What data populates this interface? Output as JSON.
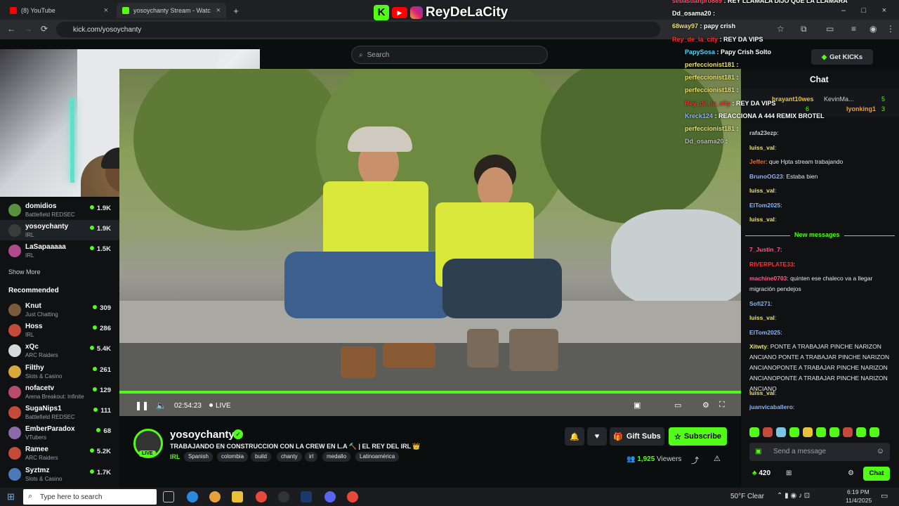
{
  "browser": {
    "tabs": [
      {
        "label": "(8) YouTube",
        "active": false
      },
      {
        "label": "yosoychanty Stream - Watc",
        "active": true
      }
    ],
    "url": "kick.com/yosoychanty",
    "new_tab": "+"
  },
  "overlay": {
    "logo_text": "ReyDeLaCity",
    "messages": [
      {
        "user": "sebastianpro889",
        "text": "REY LLAMALA DIJO QUE LA LLAMARA"
      },
      {
        "user": "Dd_osama20",
        "text": ""
      },
      {
        "user": "68way97",
        "text": "papy crish"
      },
      {
        "user": "Rey_de_la_city",
        "text": "REY DA VIPS"
      },
      {
        "user": "PapySosa",
        "text": "Papy Crish Solto"
      },
      {
        "user": "perfeccionist181",
        "text": ""
      },
      {
        "user": "perfeccionist181",
        "text": ""
      },
      {
        "user": "perfeccionist181",
        "text": ""
      },
      {
        "user": "Rey_de_la_city",
        "text": "REY DA VIPS"
      },
      {
        "user": "Kreck124",
        "text": "REACCIONA A 444 REMIX BROTEL"
      },
      {
        "user": "perfeccionist181",
        "text": ""
      },
      {
        "user": "Dd_osama20",
        "text": ""
      }
    ]
  },
  "topnav": {
    "search_placeholder": "Search",
    "get_kicks": "Get KICKs"
  },
  "sidebar": {
    "following": [
      {
        "name": "domidios",
        "category": "Battlefield REDSEC",
        "viewers": "1.9K",
        "color": "#5a8f3c"
      },
      {
        "name": "yosoychanty",
        "category": "IRL",
        "viewers": "1.9K",
        "color": "#3b3b3b",
        "active": true
      },
      {
        "name": "LaSapaaaaa",
        "category": "IRL",
        "viewers": "1.5K",
        "color": "#b04a8a"
      }
    ],
    "show_more": "Show More",
    "recommended_header": "Recommended",
    "recommended": [
      {
        "name": "Knut",
        "category": "Just Chatting",
        "viewers": "309",
        "color": "#7a5a3a"
      },
      {
        "name": "Hoss",
        "category": "IRL",
        "viewers": "286",
        "color": "#c44a3a"
      },
      {
        "name": "xQc",
        "category": "ARC Raiders",
        "viewers": "5.4K",
        "color": "#d8d8d8"
      },
      {
        "name": "Filthy",
        "category": "Slots & Casino",
        "viewers": "261",
        "color": "#d8a83a"
      },
      {
        "name": "nofacetv",
        "category": "Arena Breakout: Infinite",
        "viewers": "129",
        "color": "#b84a6a"
      },
      {
        "name": "SugaNips1",
        "category": "Battlefield REDSEC",
        "viewers": "111",
        "color": "#c44a3a"
      },
      {
        "name": "EmberParadox",
        "category": "VTubers",
        "viewers": "68",
        "color": "#8a6aa8"
      },
      {
        "name": "Ramee",
        "category": "ARC Raiders",
        "viewers": "5.2K",
        "color": "#c44a3a"
      },
      {
        "name": "Syztmz",
        "category": "Slots & Casino",
        "viewers": "1.7K",
        "color": "#4a7ab8"
      }
    ]
  },
  "player": {
    "time": "02:54:23",
    "live_label": "LIVE",
    "progress": 1.0
  },
  "stream": {
    "streamer": "yosoychanty",
    "live_badge": "LIVE",
    "title": "TRABAJANDO EN CONSTRUCCION CON LA CREW EN L.A 🔨 | EL REY DEL IRL 👑",
    "category": "IRL",
    "tags": [
      "Spanish",
      "colombia",
      "build",
      "chanty",
      "irl",
      "medallo",
      "Latinoamérica"
    ],
    "gift_subs": "Gift Subs",
    "subscribe": "Subscribe",
    "viewer_count": "1,925",
    "viewers_label": "Viewers"
  },
  "chat": {
    "header": "Chat",
    "pinned": [
      {
        "user": "brayant10wes",
        "count": "6"
      },
      {
        "user": "KevinMa...",
        "count": "5"
      },
      {
        "user": "lyonking1",
        "count": "3"
      }
    ],
    "messages": [
      {
        "user": "rafa23ezp",
        "text": "",
        "color": "#c9c9c9"
      },
      {
        "user": "luiss_val",
        "text": "",
        "color": "#e8e070"
      },
      {
        "user": "Jeffer",
        "text": "que Hpta stream trabajando",
        "color": "#e07030"
      },
      {
        "user": "BrunoOG23",
        "text": "Estaba bien",
        "color": "#8ab4f8"
      },
      {
        "user": "luiss_val",
        "text": "",
        "color": "#e8e070"
      },
      {
        "user": "ElTom2025",
        "text": "",
        "color": "#8ab4f8"
      },
      {
        "user": "luiss_val",
        "text": "",
        "color": "#e8e070"
      }
    ],
    "new_messages": "New messages",
    "messages_after": [
      {
        "user": "7_Justin_7",
        "text": "",
        "color": "#ff5a8a"
      },
      {
        "user": "RIVERPLATE33",
        "text": "",
        "color": "#ff3030"
      },
      {
        "user": "machine0703",
        "text": "quinten ese chaleco va a llegar migración pendejos",
        "color": "#ff5a8a"
      },
      {
        "user": "Sofi271",
        "text": "",
        "color": "#8ab4f8"
      },
      {
        "user": "luiss_val",
        "text": "",
        "color": "#e8e070"
      },
      {
        "user": "ElTom2025",
        "text": "",
        "color": "#8ab4f8"
      },
      {
        "user": "Xitwty",
        "text": "PONTE A TRABAJAR PINCHE NARIZON ANCIANO PONTE A TRABAJAR PINCHE NARIZON ANCIANOPONTE A TRABAJAR PINCHE NARIZON ANCIANOPONTE A TRABAJAR PINCHE NARIZON ANCIANO",
        "color": "#e8e070"
      },
      {
        "user": "luiss_val",
        "text": "",
        "color": "#e8e070"
      },
      {
        "user": "juanvicaballero",
        "text": "",
        "color": "#8ab4f8"
      }
    ],
    "input_placeholder": "Send a message",
    "points": "420",
    "send_button": "Chat"
  },
  "taskbar": {
    "search_placeholder": "Type here to search",
    "weather": "50°F  Clear",
    "time": "6:19 PM",
    "date": "11/4/2025"
  },
  "colors": {
    "kick_green": "#53fc18",
    "background": "#0b0e0f"
  }
}
